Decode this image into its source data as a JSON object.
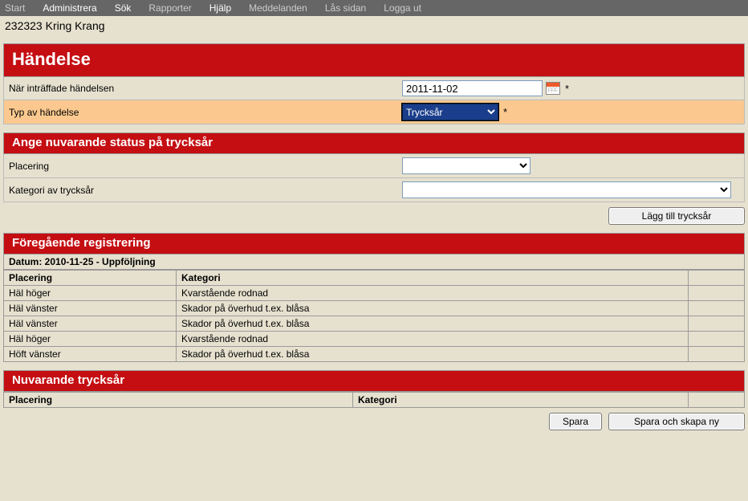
{
  "nav": {
    "start": "Start",
    "admin": "Administrera",
    "search": "Sök",
    "reports": "Rapporter",
    "help": "Hjälp",
    "messages": "Meddelanden",
    "lock": "Lås sidan",
    "logout": "Logga ut"
  },
  "patient": "232323 Kring Krang",
  "sections": {
    "event": "Händelse",
    "status": "Ange nuvarande status på trycksår",
    "previous": "Föregående registrering",
    "current": "Nuvarande trycksår"
  },
  "labels": {
    "when": "När inträffade händelsen",
    "type": "Typ av händelse",
    "placement": "Placering",
    "category": "Kategori av trycksår",
    "required": "*"
  },
  "fields": {
    "date": "2011-11-02",
    "type": "Trycksår",
    "placement": "",
    "category": ""
  },
  "buttons": {
    "add": "Lägg till trycksår",
    "save": "Spara",
    "save_new": "Spara och skapa ny"
  },
  "previous": {
    "header": "Datum: 2010-11-25 - Uppföljning",
    "cols": {
      "placement": "Placering",
      "category": "Kategori"
    },
    "rows": [
      {
        "p": "Häl höger",
        "k": "Kvarstående rodnad"
      },
      {
        "p": "Häl vänster",
        "k": "Skador på överhud t.ex. blåsa"
      },
      {
        "p": "Häl vänster",
        "k": "Skador på överhud t.ex. blåsa"
      },
      {
        "p": "Häl höger",
        "k": "Kvarstående rodnad"
      },
      {
        "p": "Höft vänster",
        "k": "Skador på överhud t.ex. blåsa"
      }
    ]
  },
  "current": {
    "cols": {
      "placement": "Placering",
      "category": "Kategori"
    }
  }
}
